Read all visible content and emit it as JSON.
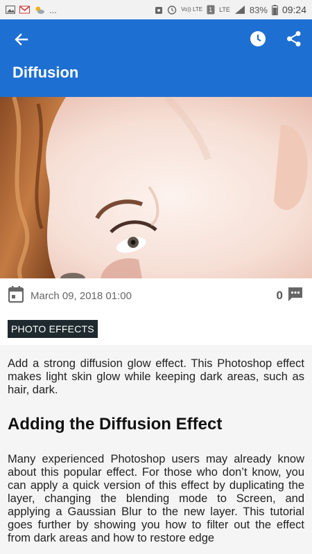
{
  "status_bar": {
    "battery": "83%",
    "time": "09:24",
    "overflow": "...",
    "vo_lte": "Vo)) LTE",
    "lte": "LTE",
    "sim": "1"
  },
  "app_bar": {
    "title": "Diffusion",
    "color": "#1e6fd2"
  },
  "meta": {
    "date": "March 09, 2018 01:00",
    "comment_count": "0"
  },
  "tag": {
    "label": "PHOTO EFFECTS"
  },
  "article": {
    "intro": "Add a strong diffusion glow effect. This Photoshop effect makes light skin glow while keeping dark areas, such as hair, dark.",
    "heading": "Adding the Diffusion Effect",
    "body": "Many experienced Photoshop users may already know about this popular effect. For those who don’t know, you can apply a quick version of this effect by duplicating the layer, changing the blending mode to Screen, and applying a Gaussian Blur to the new layer. This tutorial goes further by showing you how to filter out the effect from dark areas and how to restore edge"
  },
  "icons": {
    "back": "arrow-back-icon",
    "history": "clock-icon",
    "share": "share-icon",
    "calendar": "calendar-icon",
    "comment": "comment-icon"
  }
}
